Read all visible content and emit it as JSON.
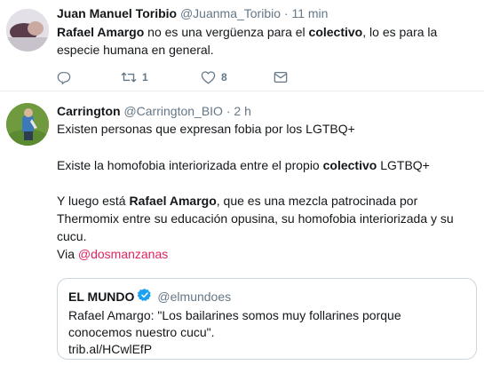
{
  "tweet1": {
    "author_name": "Juan Manuel Toribio",
    "author_handle": "@Juanma_Toribio",
    "separator": "·",
    "time": "11 min",
    "text": {
      "part1": "Rafael Amargo",
      "part2": " no es una vergüenza para el ",
      "part3": "colectivo",
      "part4": ", lo es para la especie humana en general."
    },
    "actions": {
      "reply_icon": "reply-icon",
      "retweet_icon": "retweet-icon",
      "retweet_count": "1",
      "like_icon": "heart-icon",
      "like_count": "8",
      "dm_icon": "envelope-icon"
    }
  },
  "tweet2": {
    "author_name": "Carrington",
    "author_handle": "@Carrington_BIO",
    "separator": "·",
    "time": "2 h",
    "lines": {
      "line1": "Existen personas que expresan fobia por los LGTBQ+",
      "line2_a": "Existe la homofobia interiorizada entre el propio ",
      "line2_b": "colectivo",
      "line2_c": " LGTBQ+",
      "line3_a": "Y luego está ",
      "line3_b": "Rafael Amargo",
      "line3_c": ", que es una mezcla patrocinada por Thermomix entre su educación opusina, su homofobia interiorizada y su cucu.",
      "line4_a": "Via ",
      "line4_b": "@dosmanzanas"
    },
    "quote": {
      "name": "EL MUNDO",
      "handle": "@elmundoes",
      "text": "Rafael Amargo: \"Los bailarines somos muy follarines porque conocemos nuestro cucu\".",
      "link": "trib.al/HCwlEfP"
    }
  }
}
